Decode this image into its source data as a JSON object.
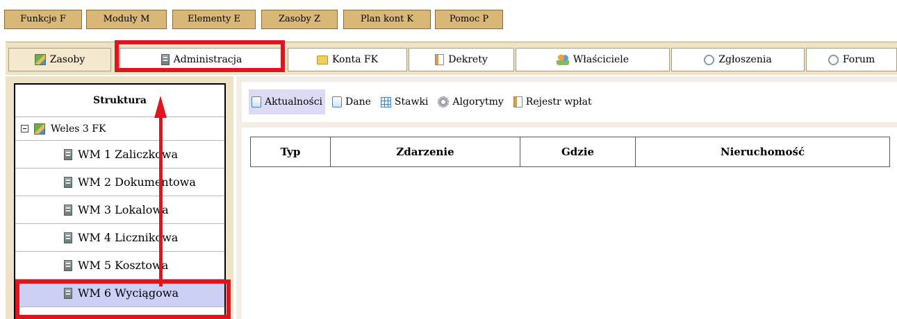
{
  "menu": [
    {
      "label": "Funkcje F"
    },
    {
      "label": "Moduły M"
    },
    {
      "label": "Elementy E"
    },
    {
      "label": "Zasoby Z"
    },
    {
      "label": "Plan kont K"
    },
    {
      "label": "Pomoc P"
    }
  ],
  "tabs": [
    {
      "label": "Zasoby",
      "icon": "map-icon"
    },
    {
      "label": "Administracja",
      "icon": "building-icon"
    },
    {
      "label": "Konta FK",
      "icon": "folder-icon"
    },
    {
      "label": "Dekrety",
      "icon": "document-icon"
    },
    {
      "label": "Właściciele",
      "icon": "people-icon"
    },
    {
      "label": "Zgłoszenia",
      "icon": "paperclip-icon"
    },
    {
      "label": "Forum",
      "icon": "paperclip-icon"
    }
  ],
  "structure": {
    "title": "Struktura",
    "root": "Weles 3 FK",
    "items": [
      {
        "label": "WM 1 Zaliczkowa"
      },
      {
        "label": "WM 2 Dokumentowa"
      },
      {
        "label": "WM 3 Lokalowa"
      },
      {
        "label": "WM 4 Licznikowa"
      },
      {
        "label": "WM 5 Kosztowa"
      },
      {
        "label": "WM 6 Wyciągowa"
      }
    ],
    "selected": "WM 6 Wyciągowa"
  },
  "subtabs": [
    {
      "label": "Aktualności",
      "icon": "page-icon"
    },
    {
      "label": "Dane",
      "icon": "page-icon"
    },
    {
      "label": "Stawki",
      "icon": "grid-icon"
    },
    {
      "label": "Algorytmy",
      "icon": "gear-icon"
    },
    {
      "label": "Rejestr wpłat",
      "icon": "document-icon"
    }
  ],
  "table": {
    "columns": [
      "Typ",
      "Zdarzenie",
      "Gdzie",
      "Nieruchomość"
    ],
    "rows": []
  },
  "colors": {
    "menu_button": "#d9b777",
    "tab_strip": "#efe3c6",
    "selected_row": "#cdd0f5",
    "annotation": "#e0141e"
  }
}
